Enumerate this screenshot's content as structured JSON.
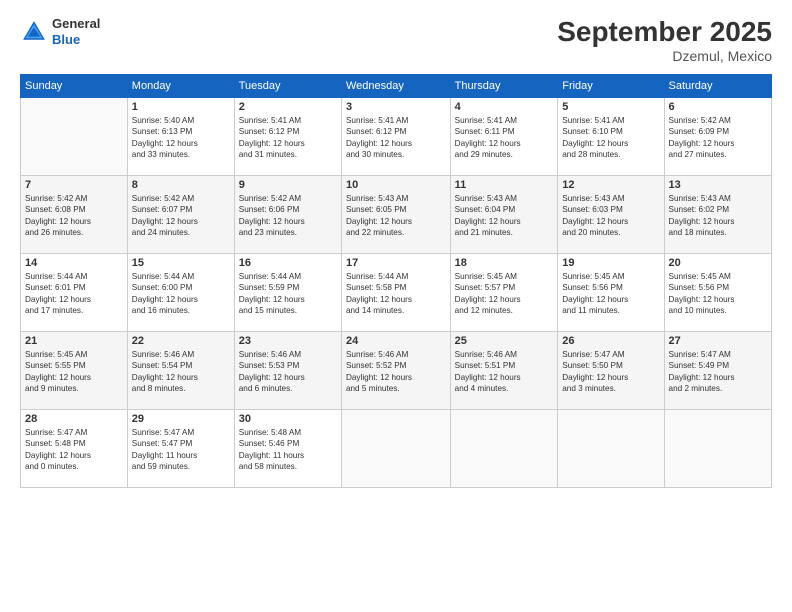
{
  "header": {
    "logo": {
      "line1": "General",
      "line2": "Blue"
    },
    "title": "September 2025",
    "location": "Dzemul, Mexico"
  },
  "weekdays": [
    "Sunday",
    "Monday",
    "Tuesday",
    "Wednesday",
    "Thursday",
    "Friday",
    "Saturday"
  ],
  "weeks": [
    [
      {
        "day": "",
        "info": ""
      },
      {
        "day": "1",
        "info": "Sunrise: 5:40 AM\nSunset: 6:13 PM\nDaylight: 12 hours\nand 33 minutes."
      },
      {
        "day": "2",
        "info": "Sunrise: 5:41 AM\nSunset: 6:12 PM\nDaylight: 12 hours\nand 31 minutes."
      },
      {
        "day": "3",
        "info": "Sunrise: 5:41 AM\nSunset: 6:12 PM\nDaylight: 12 hours\nand 30 minutes."
      },
      {
        "day": "4",
        "info": "Sunrise: 5:41 AM\nSunset: 6:11 PM\nDaylight: 12 hours\nand 29 minutes."
      },
      {
        "day": "5",
        "info": "Sunrise: 5:41 AM\nSunset: 6:10 PM\nDaylight: 12 hours\nand 28 minutes."
      },
      {
        "day": "6",
        "info": "Sunrise: 5:42 AM\nSunset: 6:09 PM\nDaylight: 12 hours\nand 27 minutes."
      }
    ],
    [
      {
        "day": "7",
        "info": "Sunrise: 5:42 AM\nSunset: 6:08 PM\nDaylight: 12 hours\nand 26 minutes."
      },
      {
        "day": "8",
        "info": "Sunrise: 5:42 AM\nSunset: 6:07 PM\nDaylight: 12 hours\nand 24 minutes."
      },
      {
        "day": "9",
        "info": "Sunrise: 5:42 AM\nSunset: 6:06 PM\nDaylight: 12 hours\nand 23 minutes."
      },
      {
        "day": "10",
        "info": "Sunrise: 5:43 AM\nSunset: 6:05 PM\nDaylight: 12 hours\nand 22 minutes."
      },
      {
        "day": "11",
        "info": "Sunrise: 5:43 AM\nSunset: 6:04 PM\nDaylight: 12 hours\nand 21 minutes."
      },
      {
        "day": "12",
        "info": "Sunrise: 5:43 AM\nSunset: 6:03 PM\nDaylight: 12 hours\nand 20 minutes."
      },
      {
        "day": "13",
        "info": "Sunrise: 5:43 AM\nSunset: 6:02 PM\nDaylight: 12 hours\nand 18 minutes."
      }
    ],
    [
      {
        "day": "14",
        "info": "Sunrise: 5:44 AM\nSunset: 6:01 PM\nDaylight: 12 hours\nand 17 minutes."
      },
      {
        "day": "15",
        "info": "Sunrise: 5:44 AM\nSunset: 6:00 PM\nDaylight: 12 hours\nand 16 minutes."
      },
      {
        "day": "16",
        "info": "Sunrise: 5:44 AM\nSunset: 5:59 PM\nDaylight: 12 hours\nand 15 minutes."
      },
      {
        "day": "17",
        "info": "Sunrise: 5:44 AM\nSunset: 5:58 PM\nDaylight: 12 hours\nand 14 minutes."
      },
      {
        "day": "18",
        "info": "Sunrise: 5:45 AM\nSunset: 5:57 PM\nDaylight: 12 hours\nand 12 minutes."
      },
      {
        "day": "19",
        "info": "Sunrise: 5:45 AM\nSunset: 5:56 PM\nDaylight: 12 hours\nand 11 minutes."
      },
      {
        "day": "20",
        "info": "Sunrise: 5:45 AM\nSunset: 5:56 PM\nDaylight: 12 hours\nand 10 minutes."
      }
    ],
    [
      {
        "day": "21",
        "info": "Sunrise: 5:45 AM\nSunset: 5:55 PM\nDaylight: 12 hours\nand 9 minutes."
      },
      {
        "day": "22",
        "info": "Sunrise: 5:46 AM\nSunset: 5:54 PM\nDaylight: 12 hours\nand 8 minutes."
      },
      {
        "day": "23",
        "info": "Sunrise: 5:46 AM\nSunset: 5:53 PM\nDaylight: 12 hours\nand 6 minutes."
      },
      {
        "day": "24",
        "info": "Sunrise: 5:46 AM\nSunset: 5:52 PM\nDaylight: 12 hours\nand 5 minutes."
      },
      {
        "day": "25",
        "info": "Sunrise: 5:46 AM\nSunset: 5:51 PM\nDaylight: 12 hours\nand 4 minutes."
      },
      {
        "day": "26",
        "info": "Sunrise: 5:47 AM\nSunset: 5:50 PM\nDaylight: 12 hours\nand 3 minutes."
      },
      {
        "day": "27",
        "info": "Sunrise: 5:47 AM\nSunset: 5:49 PM\nDaylight: 12 hours\nand 2 minutes."
      }
    ],
    [
      {
        "day": "28",
        "info": "Sunrise: 5:47 AM\nSunset: 5:48 PM\nDaylight: 12 hours\nand 0 minutes."
      },
      {
        "day": "29",
        "info": "Sunrise: 5:47 AM\nSunset: 5:47 PM\nDaylight: 11 hours\nand 59 minutes."
      },
      {
        "day": "30",
        "info": "Sunrise: 5:48 AM\nSunset: 5:46 PM\nDaylight: 11 hours\nand 58 minutes."
      },
      {
        "day": "",
        "info": ""
      },
      {
        "day": "",
        "info": ""
      },
      {
        "day": "",
        "info": ""
      },
      {
        "day": "",
        "info": ""
      }
    ]
  ]
}
